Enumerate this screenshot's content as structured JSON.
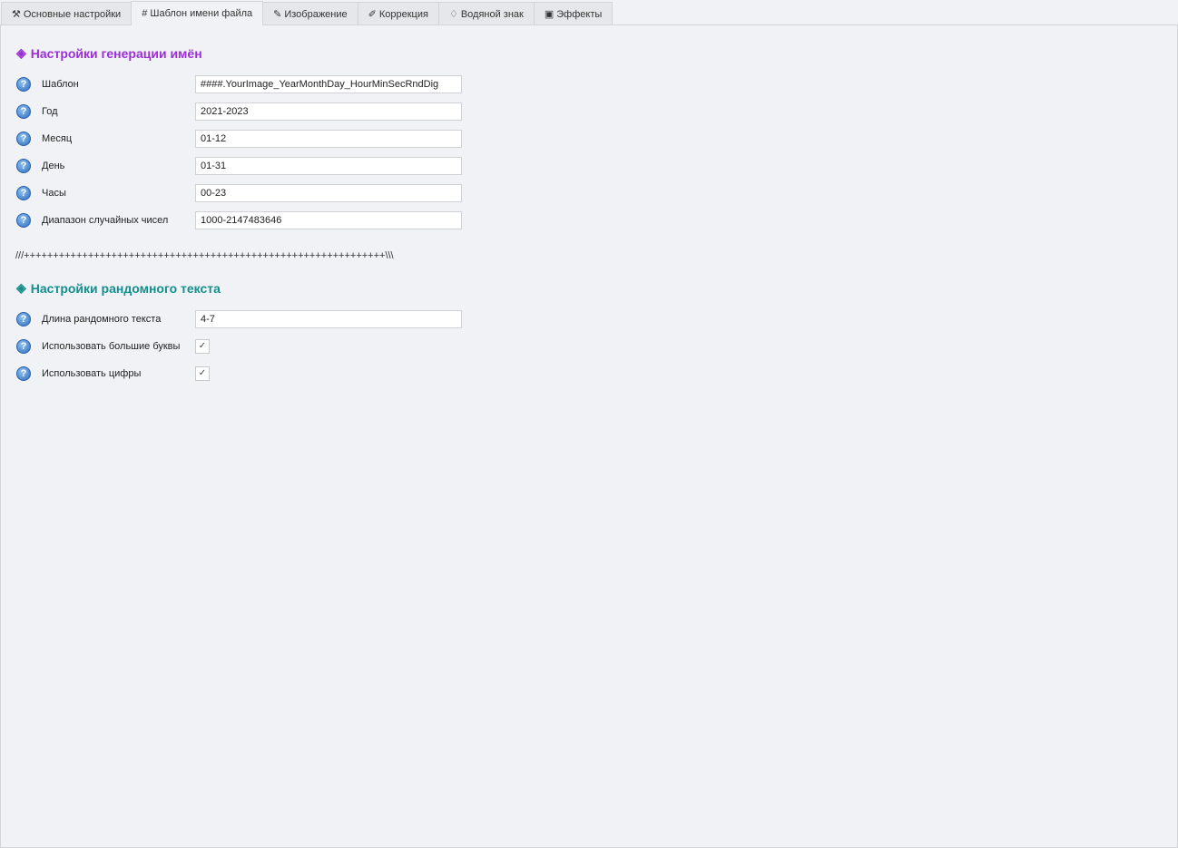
{
  "tabs": [
    {
      "label": "Основные настройки",
      "icon": "tools-icon"
    },
    {
      "label": "# Шаблон имени файла",
      "icon": ""
    },
    {
      "label": "Изображение",
      "icon": "pin-icon"
    },
    {
      "label": "Коррекция",
      "icon": "pen-icon"
    },
    {
      "label": "Водяной знак",
      "icon": "drop-icon"
    },
    {
      "label": "Эффекты",
      "icon": "effects-icon"
    }
  ],
  "active_tab": 1,
  "section1": {
    "title": "Настройки генерации имён",
    "fields": [
      {
        "label": "Шаблон",
        "value": "####.YourImage_YearMonthDay_HourMinSecRndDig"
      },
      {
        "label": "Год",
        "value": "2021-2023"
      },
      {
        "label": "Месяц",
        "value": "01-12"
      },
      {
        "label": "День",
        "value": "01-31"
      },
      {
        "label": "Часы",
        "value": "00-23"
      },
      {
        "label": "Диапазон случайных чисел",
        "value": "1000-2147483646"
      }
    ]
  },
  "separator": "///++++++++++++++++++++++++++++++++++++++++++++++++++++++++++++++\\\\\\",
  "section2": {
    "title": "Настройки рандомного текста",
    "length": {
      "label": "Длина рандомного текста",
      "value": "4-7"
    },
    "uppercase": {
      "label": "Использовать большие буквы",
      "checked": true
    },
    "digits": {
      "label": "Использовать цифры",
      "checked": true
    }
  }
}
